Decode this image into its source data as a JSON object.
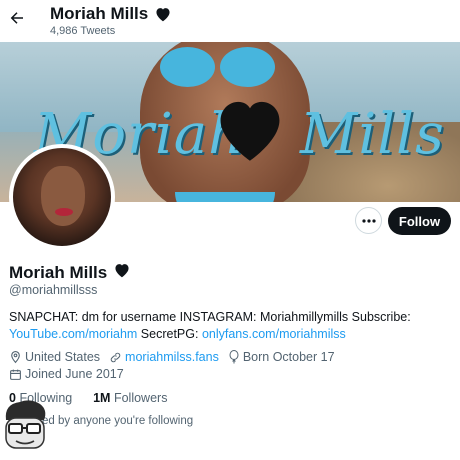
{
  "header": {
    "name": "Moriah Mills",
    "tweet_count": "4,986 Tweets"
  },
  "banner": {
    "script_left": "Moriah",
    "script_right": "Mills"
  },
  "actions": {
    "follow_label": "Follow"
  },
  "profile": {
    "name": "Moriah Mills",
    "handle": "@moriahmillsss",
    "bio_text": "SNAPCHAT: dm for username INSTAGRAM: Moriahmillymills Subscribe:",
    "bio_link1": "YouTube.com/moriahm",
    "bio_mid": "SecretPG:",
    "bio_link2": "onlyfans.com/moriahmilss",
    "location": "United States",
    "website": "moriahmilss.fans",
    "born": "Born October 17",
    "joined": "Joined June 2017",
    "following_count": "0",
    "following_label": "Following",
    "followers_count": "1M",
    "followers_label": "Followers",
    "not_followed": "ed by anyone you're following"
  },
  "colors": {
    "accent": "#1d9bf0",
    "text": "#0f1419",
    "muted": "#536471",
    "follow_bg": "#0f1419"
  },
  "icons": [
    "back-arrow-icon",
    "black-heart-icon",
    "more-icon",
    "location-icon",
    "link-icon",
    "balloon-icon",
    "calendar-icon"
  ]
}
